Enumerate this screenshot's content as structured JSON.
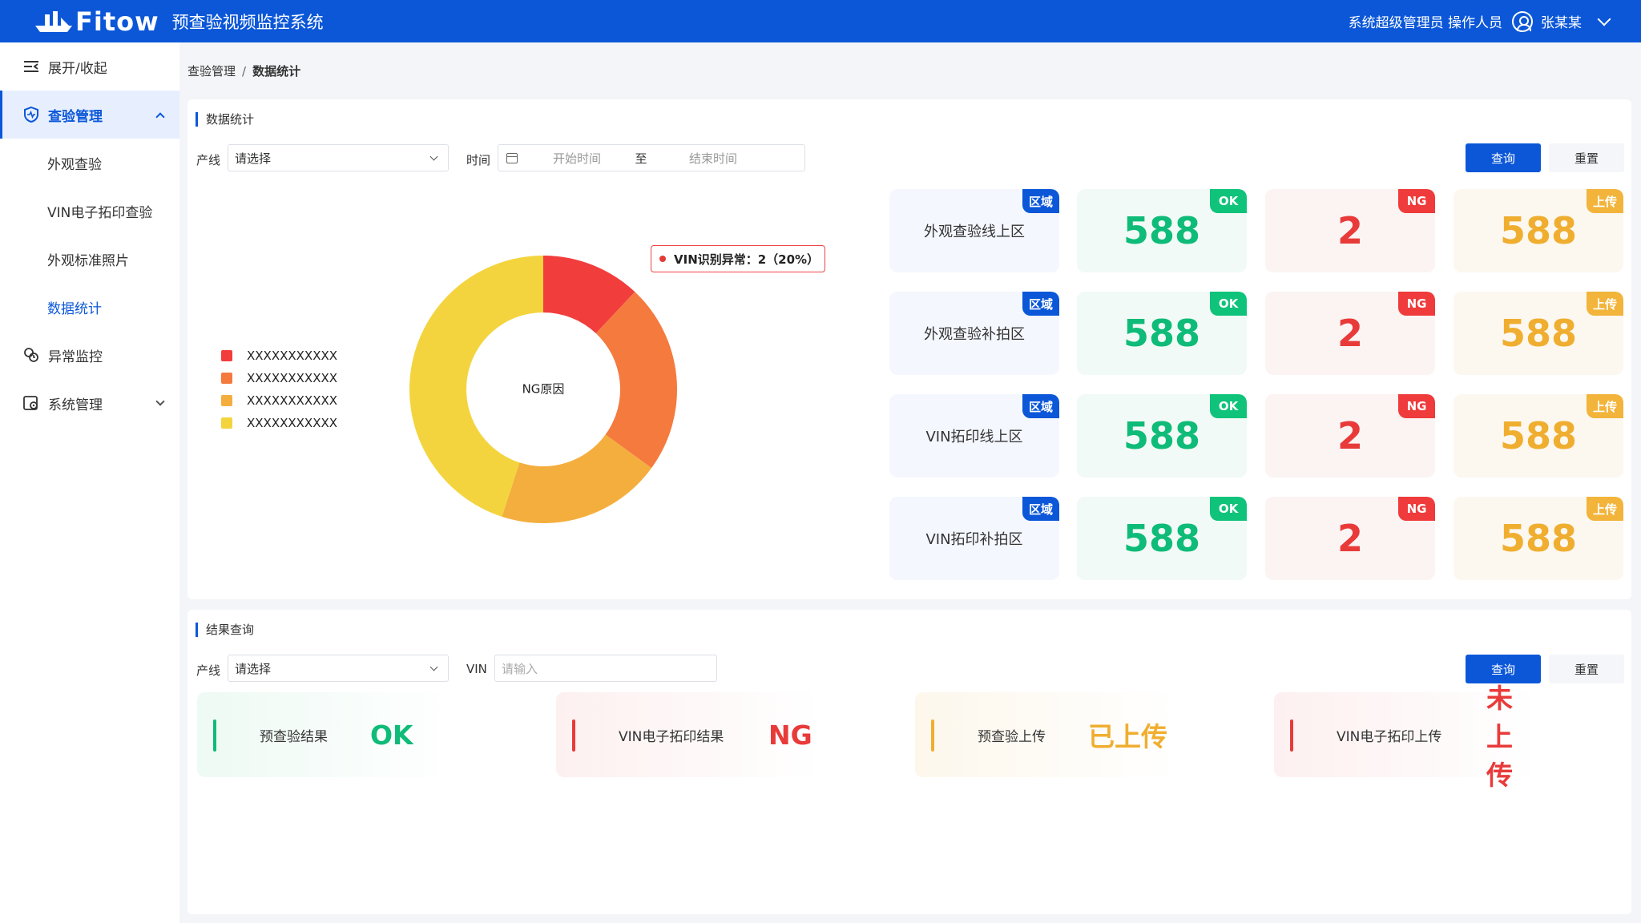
{
  "header": {
    "brand": "Fitow",
    "title": "预查验视频监控系统",
    "roles": "系统超级管理员 操作人员",
    "user": "张某某"
  },
  "sidebar": {
    "toggle": "展开/收起",
    "items": [
      {
        "label": "查验管理"
      },
      {
        "label": "外观查验"
      },
      {
        "label": "VIN电子拓印查验"
      },
      {
        "label": "外观标准照片"
      },
      {
        "label": "数据统计"
      },
      {
        "label": "异常监控"
      },
      {
        "label": "系统管理"
      }
    ]
  },
  "breadcrumb": {
    "parent": "查验管理",
    "sep": "/",
    "current": "数据统计"
  },
  "stats": {
    "title": "数据统计",
    "line_label": "产线",
    "line_value": "请选择",
    "time_label": "时间",
    "start_placeholder": "开始时间",
    "to": "至",
    "end_placeholder": "结束时间",
    "query": "查询",
    "reset": "重置"
  },
  "chart_data": {
    "type": "pie",
    "title": "NG原因",
    "categories": [
      "XXXXXXXXXXX",
      "XXXXXXXXXXX",
      "XXXXXXXXXXX",
      "XXXXXXXXXXX"
    ],
    "values": [
      12,
      23,
      20,
      45
    ],
    "colors": [
      "#f23d3d",
      "#f47a3e",
      "#f4ae3e",
      "#f4d43e"
    ],
    "legend_position": "left",
    "tooltip": "VIN识别异常：2（20%）"
  },
  "cards": {
    "tags": {
      "area": "区域",
      "ok": "OK",
      "ng": "NG",
      "up": "上传"
    },
    "rows": [
      {
        "area": "外观查验线上区",
        "ok": "588",
        "ng": "2",
        "up": "588"
      },
      {
        "area": "外观查验补拍区",
        "ok": "588",
        "ng": "2",
        "up": "588"
      },
      {
        "area": "VIN拓印线上区",
        "ok": "588",
        "ng": "2",
        "up": "588"
      },
      {
        "area": "VIN拓印补拍区",
        "ok": "588",
        "ng": "2",
        "up": "588"
      }
    ]
  },
  "results": {
    "title": "结果查询",
    "line_label": "产线",
    "line_value": "请选择",
    "vin_label": "VIN",
    "vin_placeholder": "请输入",
    "query": "查询",
    "reset": "重置",
    "items": [
      {
        "label": "预查验结果",
        "value": "OK",
        "color": "#0fbb78"
      },
      {
        "label": "VIN电子拓印结果",
        "value": "NG",
        "color": "#e93a3a"
      },
      {
        "label": "预查验上传",
        "value": "已上传",
        "color": "#f0ae30"
      },
      {
        "label": "VIN电子拓印上传",
        "value": "未上传",
        "color": "#e93a3a"
      }
    ]
  }
}
